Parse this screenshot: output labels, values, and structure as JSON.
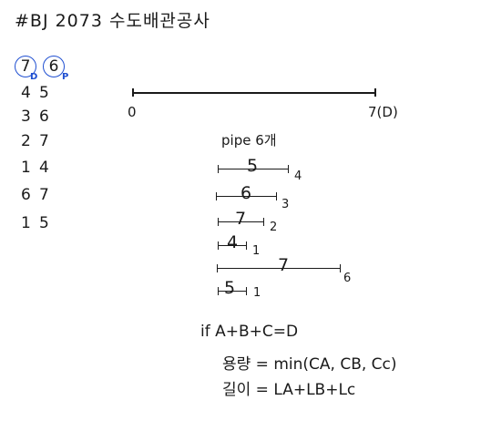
{
  "title": "#BJ 2073 수도배관공사",
  "header": {
    "d_value": "7",
    "p_value": "6",
    "d_label": "D",
    "p_label": "P"
  },
  "pipes": [
    {
      "a": "4",
      "b": "5"
    },
    {
      "a": "3",
      "b": "6"
    },
    {
      "a": "2",
      "b": "7"
    },
    {
      "a": "1",
      "b": "4"
    },
    {
      "a": "6",
      "b": "7"
    },
    {
      "a": "1",
      "b": "5"
    }
  ],
  "axis": {
    "start_label": "0",
    "end_label": "7(D)"
  },
  "pipe_count_label": "pipe 6개",
  "segments": [
    {
      "capacity": "5",
      "length": "4"
    },
    {
      "capacity": "6",
      "length": "3"
    },
    {
      "capacity": "7",
      "length": "2"
    },
    {
      "capacity": "4",
      "length": "1"
    },
    {
      "capacity": "7",
      "length": "6"
    },
    {
      "capacity": "5",
      "length": "1"
    }
  ],
  "formulas": {
    "condition": "if A+B+C=D",
    "capacity": "용량 = min(CA, CB, Cc)",
    "length": "길이 = LA+LB+Lc"
  }
}
